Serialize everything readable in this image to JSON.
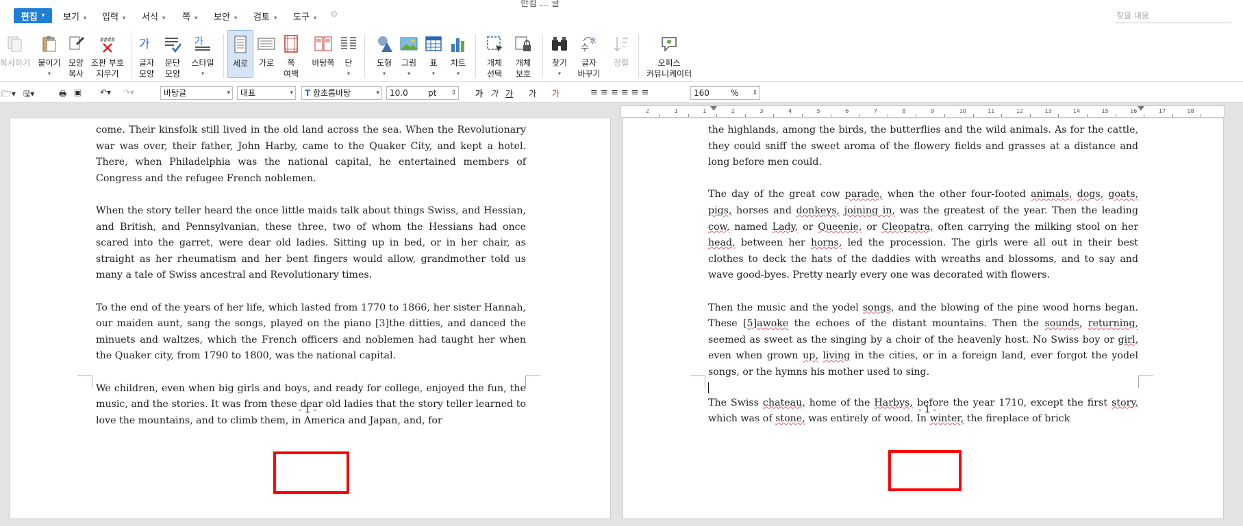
{
  "app": {
    "title": "한컴 … 글",
    "search_placeholder": "찾을 내용"
  },
  "menu": {
    "active": "편집",
    "items": [
      "보기",
      "입력",
      "서식",
      "쪽",
      "보안",
      "검토",
      "도구"
    ]
  },
  "ribbon": {
    "buttons": [
      {
        "label": "복사하기",
        "disabled": true
      },
      {
        "label": "붙이기"
      },
      {
        "label": "모양\n복사"
      },
      {
        "label": "조판 부호\n지우기"
      },
      {
        "label": "글자\n모양"
      },
      {
        "label": "문단\n모양"
      },
      {
        "label": "스타일"
      },
      {
        "label": "세로",
        "active": true
      },
      {
        "label": "가로"
      },
      {
        "label": "쪽\n여백"
      },
      {
        "label": "바탕쪽"
      },
      {
        "label": "단"
      },
      {
        "label": "도형"
      },
      {
        "label": "그림"
      },
      {
        "label": "표"
      },
      {
        "label": "차트"
      },
      {
        "label": "개체\n선택"
      },
      {
        "label": "개체\n보호"
      },
      {
        "label": "찾기"
      },
      {
        "label": "글자\n바꾸기"
      },
      {
        "label": "정렬",
        "disabled": true
      },
      {
        "label": "오피스\n커뮤니케이터"
      }
    ]
  },
  "format_toolbar": {
    "style": "바탕글",
    "lang": "대표",
    "font": "함초롬바탕",
    "size": "10.0",
    "size_unit": "pt",
    "zoom": "160",
    "zoom_unit": "%",
    "char_buttons": [
      "가",
      "가",
      "가",
      "가",
      "가"
    ]
  },
  "pages": {
    "left": {
      "paragraphs": [
        "come. Their kinsfolk still lived in the old land across the sea. When the Revolutionary war was over, their father, John Harby, came to the Quaker City, and kept a hotel. There, when Philadelphia was the national capital, he entertained members of Congress and the refugee French noblemen.",
        "When the story teller heard the once little maids talk about things Swiss, and Hessian, and British, and Pennsylvanian, these three, two of whom the Hessians had once scared into the garret, were dear old ladies. Sitting up in bed, or in her chair, as straight as her rheumatism and her bent fingers would allow, grandmother told us many a tale of Swiss ancestral and Revolutionary times.",
        "To the end of the years of her life, which lasted from 1770 to 1866, her sister Hannah, our maiden aunt, sang the songs, played on the piano [3]the ditties, and danced the minuets and waltzes, which the French officers and noblemen had taught her when the Quaker city, from 1790 to 1800, was the national capital.",
        "We children, even when big girls and boys, and ready for college, enjoyed the fun, the music, and the stories. It was from these dear old ladies that the story teller learned to love the mountains, and to climb them, in America and Japan, and, for"
      ],
      "page_number": "- 1 -"
    },
    "right": {
      "p1": "the highlands, among the birds, the butterflies and the wild animals. As for the cattle, they could sniff the sweet aroma of the flowery fields and grasses at a distance and long before men could.",
      "p2": [
        "The day of the great cow ",
        "parade,",
        " when the other four-footed ",
        "animals,",
        " ",
        "dogs,",
        " ",
        "goats,",
        " ",
        "pigs,",
        " horses and ",
        "donkeys,",
        " ",
        "joining in,",
        " was the greatest of the year. Then the leading ",
        "cow,",
        " named ",
        "Lady,",
        " or ",
        "Queenie,",
        " or ",
        "Cleopatra,",
        " often carrying the milking stool on her ",
        "head,",
        " between her ",
        "horns,",
        " led the procession. The girls were all out in their best clothes to deck the hats of the daddies with wreaths and blossoms, and to say and wave good-byes. Pretty nearly every one was decorated with flowers."
      ],
      "p3": [
        "Then the music and the yodel ",
        "songs,",
        " and the blowing of the pine wood horns began. These ",
        "[5]awoke",
        " the echoes of the distant mountains. Then the ",
        "sounds,",
        " ",
        "returning,",
        " seemed as sweet as the singing by a choir of the heavenly host. No Swiss boy or ",
        "girl,",
        " even when grown ",
        "up,",
        " ",
        "living",
        " in the cities, or in a foreign land, ever forgot the yodel songs, or the hymns his mother used to sing."
      ],
      "p4": [
        "The Swiss ",
        "chateau,",
        " home of the ",
        "Harbys,",
        " before the year 1710, except the first ",
        "story,",
        " which was of ",
        "stone,",
        " was entirely of wood. In ",
        "winter,",
        " the fireplace of brick"
      ],
      "page_number": "- 1 -"
    }
  },
  "ruler": {
    "ticks": [
      "2",
      "1",
      "1",
      "2",
      "3",
      "4",
      "5",
      "6",
      "7",
      "8",
      "9",
      "10",
      "11",
      "12",
      "13",
      "14",
      "15",
      "16",
      "17",
      "18"
    ]
  }
}
